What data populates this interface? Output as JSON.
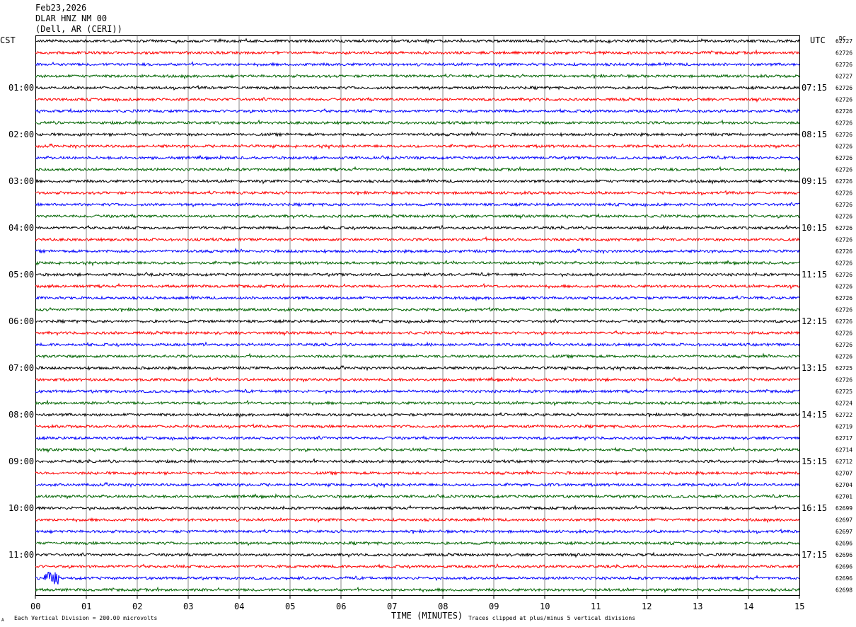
{
  "header": {
    "date": "Feb23,2026",
    "station": "DLAR HNZ NM 00",
    "location": "(Dell, AR (CERI))"
  },
  "labels": {
    "left_tz": "CST",
    "right_tz": "UTC",
    "dc_header": "DC",
    "x_title": "TIME (MINUTES)",
    "footer_left": "Each Vertical Division =  200.00 microvolts",
    "footer_right": "Traces clipped at plus/minus 5 vertical divisions",
    "corner_mark": "A"
  },
  "chart_data": {
    "type": "line",
    "title": "DLAR HNZ NM 00",
    "xlabel": "TIME (MINUTES)",
    "xlim": [
      0,
      15
    ],
    "x_ticks": [
      "00",
      "01",
      "02",
      "03",
      "04",
      "05",
      "06",
      "07",
      "08",
      "09",
      "10",
      "11",
      "12",
      "13",
      "14",
      "15"
    ],
    "trace_colors": [
      "#000000",
      "#ff0000",
      "#0000ff",
      "#006400"
    ],
    "rows_per_hour": 4,
    "hour_labels_cst": [
      "01:00",
      "02:00",
      "03:00",
      "04:00",
      "05:00",
      "06:00",
      "07:00",
      "08:00",
      "09:00",
      "10:00",
      "11:00"
    ],
    "hour_labels_utc": [
      "07:15",
      "08:15",
      "09:15",
      "10:15",
      "11:15",
      "12:15",
      "13:15",
      "14:15",
      "15:15",
      "16:15",
      "17:15"
    ],
    "dc_offsets": [
      62727,
      62726,
      62726,
      62727,
      62726,
      62726,
      62726,
      62726,
      62726,
      62726,
      62726,
      62726,
      62726,
      62726,
      62726,
      62726,
      62726,
      62726,
      62726,
      62726,
      62726,
      62726,
      62726,
      62726,
      62726,
      62726,
      62726,
      62726,
      62725,
      62726,
      62725,
      62724,
      62722,
      62719,
      62717,
      62714,
      62712,
      62707,
      62704,
      62701,
      62699,
      62697,
      62697,
      62696,
      62696,
      62696,
      62696,
      62698
    ],
    "amplitude_per_division_microvolts": 200.0,
    "clip_divisions": 5
  }
}
